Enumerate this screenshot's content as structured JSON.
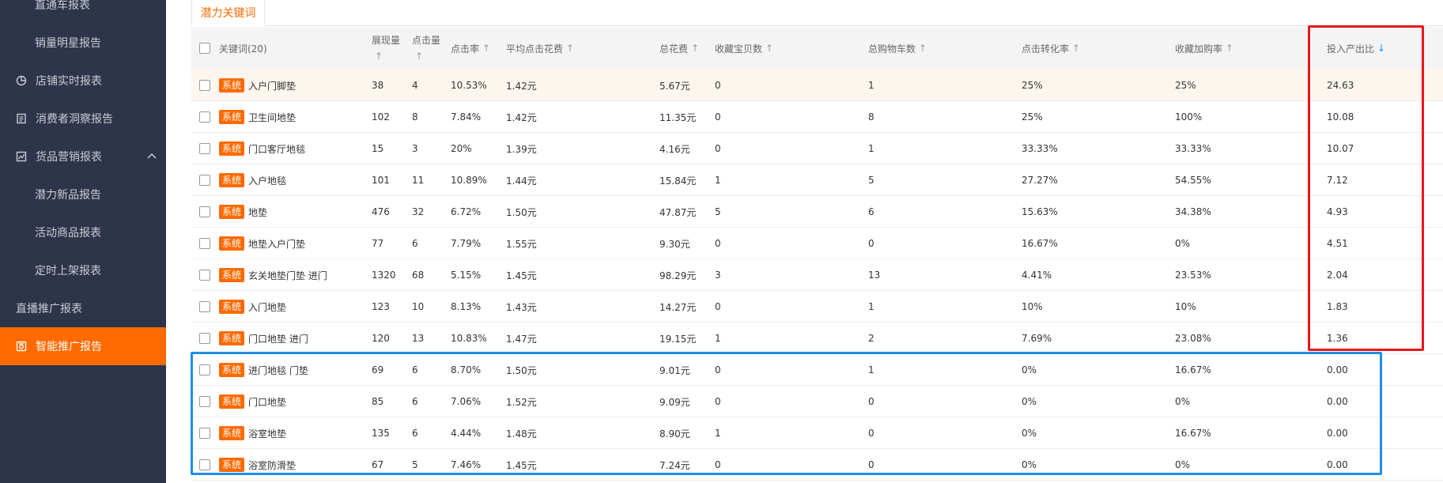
{
  "sidebar": {
    "items": [
      {
        "label": "直通车报表",
        "kind": "sub",
        "icon": "",
        "active": false
      },
      {
        "label": "销量明星报告",
        "kind": "sub",
        "icon": "",
        "active": false
      },
      {
        "label": "店铺实时报表",
        "kind": "top",
        "icon": "pie-chart-icon",
        "active": false
      },
      {
        "label": "消费者洞察报告",
        "kind": "top",
        "icon": "document-icon",
        "active": false
      },
      {
        "label": "货品营销报表",
        "kind": "top",
        "icon": "chart-icon",
        "active": false,
        "expanded": true
      },
      {
        "label": "潜力新品报告",
        "kind": "sub",
        "icon": "",
        "active": false
      },
      {
        "label": "活动商品报表",
        "kind": "sub",
        "icon": "",
        "active": false
      },
      {
        "label": "定时上架报表",
        "kind": "sub",
        "icon": "",
        "active": false
      },
      {
        "label": "直播推广报表",
        "kind": "top-noicon",
        "icon": "",
        "active": false
      },
      {
        "label": "智能推广报告",
        "kind": "top",
        "icon": "report-icon",
        "active": true
      }
    ]
  },
  "tab": {
    "label": "潜力关键词"
  },
  "table": {
    "headers": [
      "关键词(20)",
      "展现量",
      "点击量",
      "点击率",
      "平均点击花费",
      "总花费",
      "收藏宝贝数",
      "总购物车数",
      "点击转化率",
      "收藏加购率",
      "投入产出比"
    ],
    "sort_up": "↑",
    "sort_down": "↓",
    "badge": "系统",
    "rows": [
      [
        "入户门脚垫",
        "38",
        "4",
        "10.53%",
        "1.42元",
        "5.67元",
        "0",
        "1",
        "25%",
        "25%",
        "24.63"
      ],
      [
        "卫生间地垫",
        "102",
        "8",
        "7.84%",
        "1.42元",
        "11.35元",
        "0",
        "8",
        "25%",
        "100%",
        "10.08"
      ],
      [
        "门口客厅地毯",
        "15",
        "3",
        "20%",
        "1.39元",
        "4.16元",
        "0",
        "1",
        "33.33%",
        "33.33%",
        "10.07"
      ],
      [
        "入户地毯",
        "101",
        "11",
        "10.89%",
        "1.44元",
        "15.84元",
        "1",
        "5",
        "27.27%",
        "54.55%",
        "7.12"
      ],
      [
        "地垫",
        "476",
        "32",
        "6.72%",
        "1.50元",
        "47.87元",
        "5",
        "6",
        "15.63%",
        "34.38%",
        "4.93"
      ],
      [
        "地垫入户门垫",
        "77",
        "6",
        "7.79%",
        "1.55元",
        "9.30元",
        "0",
        "0",
        "16.67%",
        "0%",
        "4.51"
      ],
      [
        "玄关地垫门垫 进门",
        "1320",
        "68",
        "5.15%",
        "1.45元",
        "98.29元",
        "3",
        "13",
        "4.41%",
        "23.53%",
        "2.04"
      ],
      [
        "入门地垫",
        "123",
        "10",
        "8.13%",
        "1.43元",
        "14.27元",
        "0",
        "1",
        "10%",
        "10%",
        "1.83"
      ],
      [
        "门口地垫 进门",
        "120",
        "13",
        "10.83%",
        "1.47元",
        "19.15元",
        "1",
        "2",
        "7.69%",
        "23.08%",
        "1.36"
      ],
      [
        "进门地毯 门垫",
        "69",
        "6",
        "8.70%",
        "1.50元",
        "9.01元",
        "0",
        "1",
        "0%",
        "16.67%",
        "0.00"
      ],
      [
        "门口地垫",
        "85",
        "6",
        "7.06%",
        "1.52元",
        "9.09元",
        "0",
        "0",
        "0%",
        "0%",
        "0.00"
      ],
      [
        "浴室地垫",
        "135",
        "6",
        "4.44%",
        "1.48元",
        "8.90元",
        "1",
        "0",
        "0%",
        "16.67%",
        "0.00"
      ],
      [
        "浴室防滑垫",
        "67",
        "5",
        "7.46%",
        "1.45元",
        "7.24元",
        "0",
        "0",
        "0%",
        "0%",
        "0.00"
      ]
    ]
  },
  "colors": {
    "accent": "#ff6a00",
    "sidebar_bg": "#2e3449",
    "red_box": "#e8161b",
    "blue_box": "#1d8fe6",
    "sort_active": "#1a8fff"
  }
}
